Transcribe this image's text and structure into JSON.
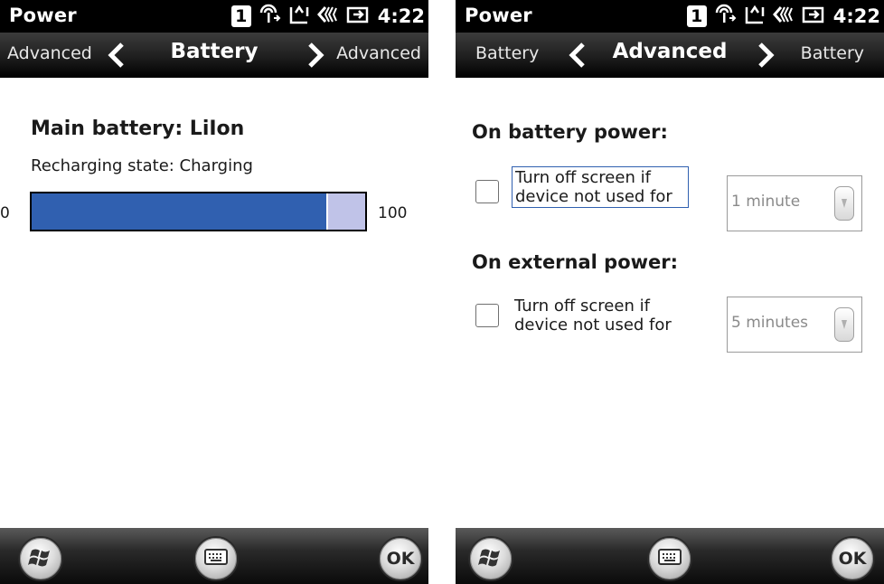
{
  "screens": {
    "battery": {
      "status": {
        "app_title": "Power",
        "sim_slot": "1",
        "time": "4:22"
      },
      "nav": {
        "prev_label": "Advanced",
        "title": "Battery",
        "next_label": "Advanced"
      },
      "main_battery_label": "Main battery:  LiIon",
      "recharging_text": "Recharging state:  Charging",
      "level": {
        "min_label": "0",
        "max_label": "100",
        "value": 89
      },
      "bottom": {
        "ok_label": "OK"
      }
    },
    "advanced": {
      "status": {
        "app_title": "Power",
        "sim_slot": "1",
        "time": "4:22"
      },
      "nav": {
        "prev_label": "Battery",
        "title": "Advanced",
        "next_label": "Battery"
      },
      "battery_power": {
        "heading": "On battery power:",
        "checkbox_line1": "Turn off screen if",
        "checkbox_line2": "device not used for",
        "checked": false,
        "timeout_value": "1 minute"
      },
      "external_power": {
        "heading": "On external power:",
        "checkbox_line1": "Turn off screen if",
        "checkbox_line2": "device not used for",
        "checked": false,
        "timeout_value": "5 minutes"
      },
      "bottom": {
        "ok_label": "OK"
      }
    }
  },
  "icons": [
    "start-icon",
    "keyboard-icon",
    "signal-icon",
    "sync-icon",
    "volume-icon",
    "battery-plug-icon",
    "chevron-left-icon",
    "chevron-right-icon"
  ],
  "colors": {
    "progress_fill": "#3060b0",
    "progress_track": "#c0c3e8",
    "focus_border": "#3060b0"
  }
}
